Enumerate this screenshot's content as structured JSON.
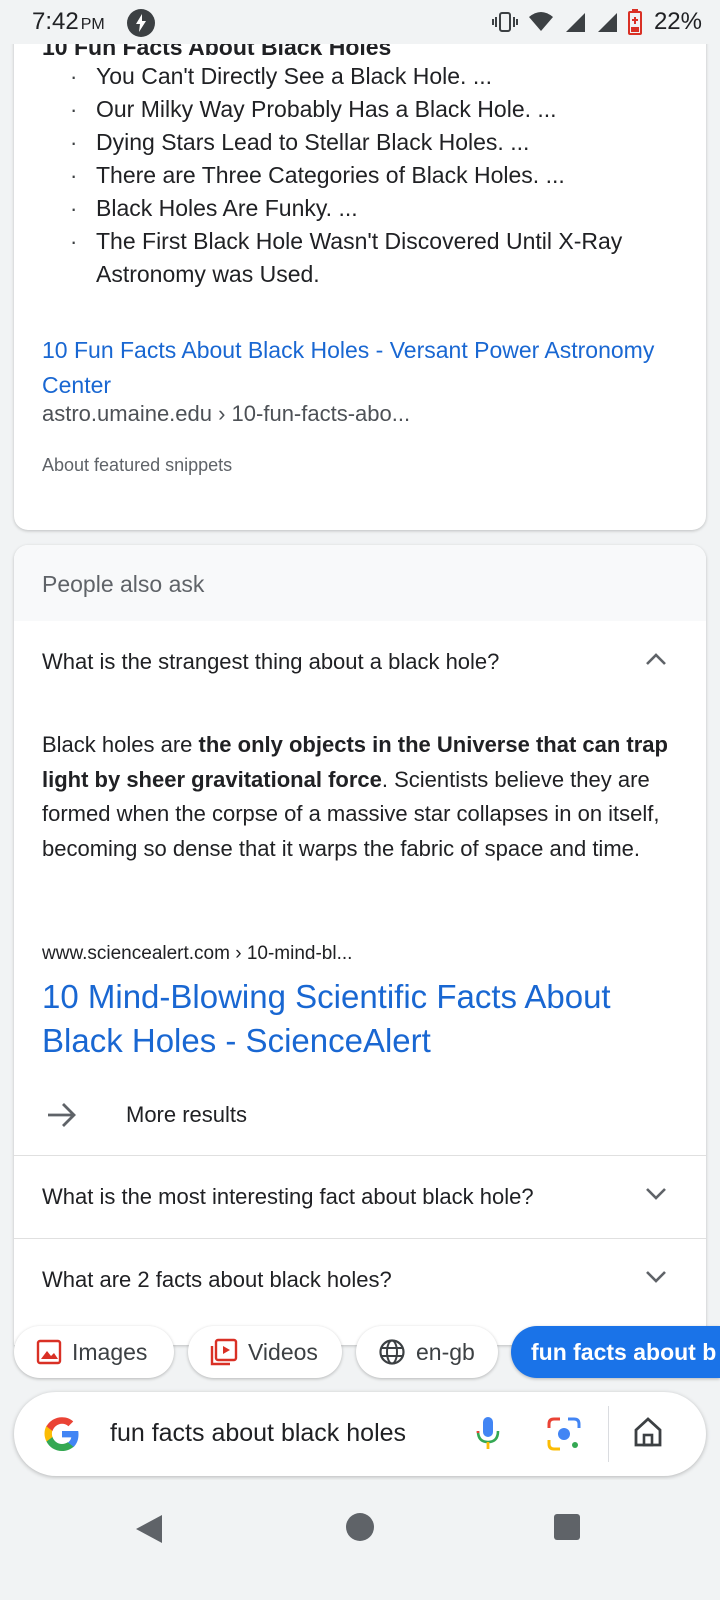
{
  "status_bar": {
    "time": "7:42",
    "ampm": "PM",
    "battery": "22%"
  },
  "snippet": {
    "heading": "10 Fun Facts About Black Holes",
    "items": [
      "You Can't Directly See a Black Hole. ...",
      "Our Milky Way Probably Has a Black Hole. ...",
      "Dying Stars Lead to Stellar Black Holes. ...",
      "There are Three Categories of Black Holes. ...",
      "Black Holes Are Funky. ...",
      "The First Black Hole Wasn't Discovered Until X-Ray",
      "Astronomy was Used."
    ],
    "link_title": "10 Fun Facts About Black Holes - Versant Power Astronomy Center",
    "url": "astro.umaine.edu › 10-fun-facts-abo...",
    "about": "About featured snippets"
  },
  "paa": {
    "title": "People also ask",
    "questions": [
      "What is the strangest thing about a black hole?",
      "What is the most interesting fact about black hole?",
      "What are 2 facts about black holes?"
    ],
    "answer": {
      "prefix": "Black holes are ",
      "bold": "the only objects in the Universe that can trap light by sheer gravitational force",
      "suffix": ". Scientists believe they are formed when the corpse of a massive star collapses in on itself, becoming so dense that it warps the fabric of space and time.",
      "url": "www.sciencealert.com › 10-mind-bl...",
      "title": "10 Mind-Blowing Scientific Facts About Black Holes - ScienceAlert"
    },
    "more": "More results"
  },
  "chips": [
    "Images",
    "Videos",
    "en-gb",
    "fun facts about b"
  ],
  "search": {
    "query": "fun facts about black holes"
  },
  "colors": {
    "link": "#1967d2",
    "chip_active": "#1a73e8"
  }
}
